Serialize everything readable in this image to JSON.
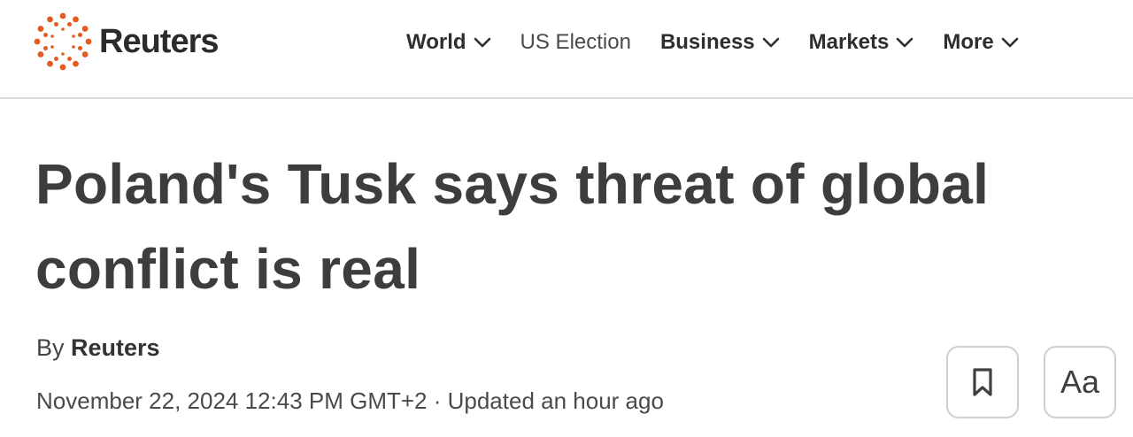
{
  "brand": {
    "name": "Reuters",
    "accent_color": "#e55b1f",
    "logo_icon": "reuters-dot-ring-icon"
  },
  "nav": {
    "items": [
      {
        "label": "World",
        "has_dropdown": true
      },
      {
        "label": "US Election",
        "has_dropdown": false
      },
      {
        "label": "Business",
        "has_dropdown": true
      },
      {
        "label": "Markets",
        "has_dropdown": true
      },
      {
        "label": "More",
        "has_dropdown": true
      }
    ]
  },
  "article": {
    "headline": "Poland's Tusk says threat of global conflict is real",
    "byline_prefix": "By",
    "author": "Reuters",
    "dateline": "November 22, 2024 12:43 PM GMT+2 · Updated an hour ago"
  },
  "actions": {
    "bookmark_icon": "bookmark-icon",
    "font_size_label": "Aa"
  }
}
